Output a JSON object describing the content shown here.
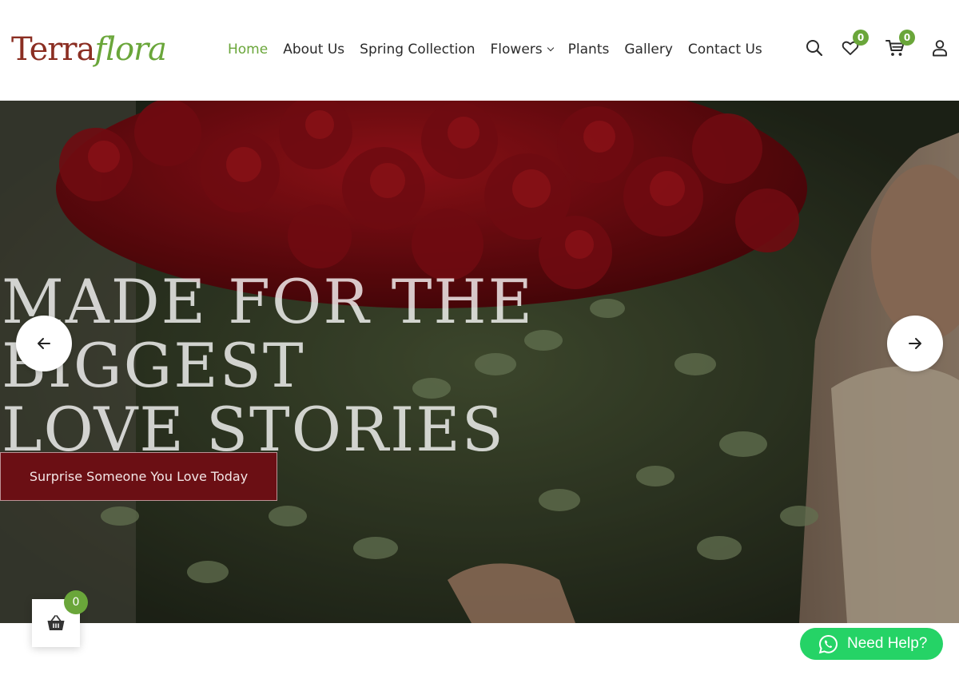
{
  "brand": {
    "part1": "Terra",
    "part2": "flora"
  },
  "nav": {
    "items": [
      {
        "label": "Home",
        "active": true
      },
      {
        "label": "About Us"
      },
      {
        "label": "Spring Collection"
      },
      {
        "label": "Flowers",
        "has_dropdown": true
      },
      {
        "label": "Plants"
      },
      {
        "label": "Gallery"
      },
      {
        "label": "Contact Us"
      }
    ]
  },
  "header_icons": {
    "search": "search-icon",
    "wishlist": {
      "icon": "heart-icon",
      "count": "0"
    },
    "cart": {
      "icon": "cart-icon",
      "count": "0"
    },
    "account": "user-icon"
  },
  "hero": {
    "headline": [
      "MADE FOR THE",
      "BIGGEST",
      "LOVE STORIES"
    ],
    "cta_label": "Surprise Someone You Love Today",
    "prev_icon": "arrow-left-icon",
    "next_icon": "arrow-right-icon"
  },
  "floating_cart": {
    "icon": "basket-icon",
    "count": "0"
  },
  "whatsapp": {
    "icon": "whatsapp-icon",
    "label": "Need Help?"
  },
  "colors": {
    "accent_green": "#6aa63a",
    "brand_red": "#8b2e22",
    "cta_bg": "#6b0f14",
    "whatsapp_green": "#25d366"
  }
}
